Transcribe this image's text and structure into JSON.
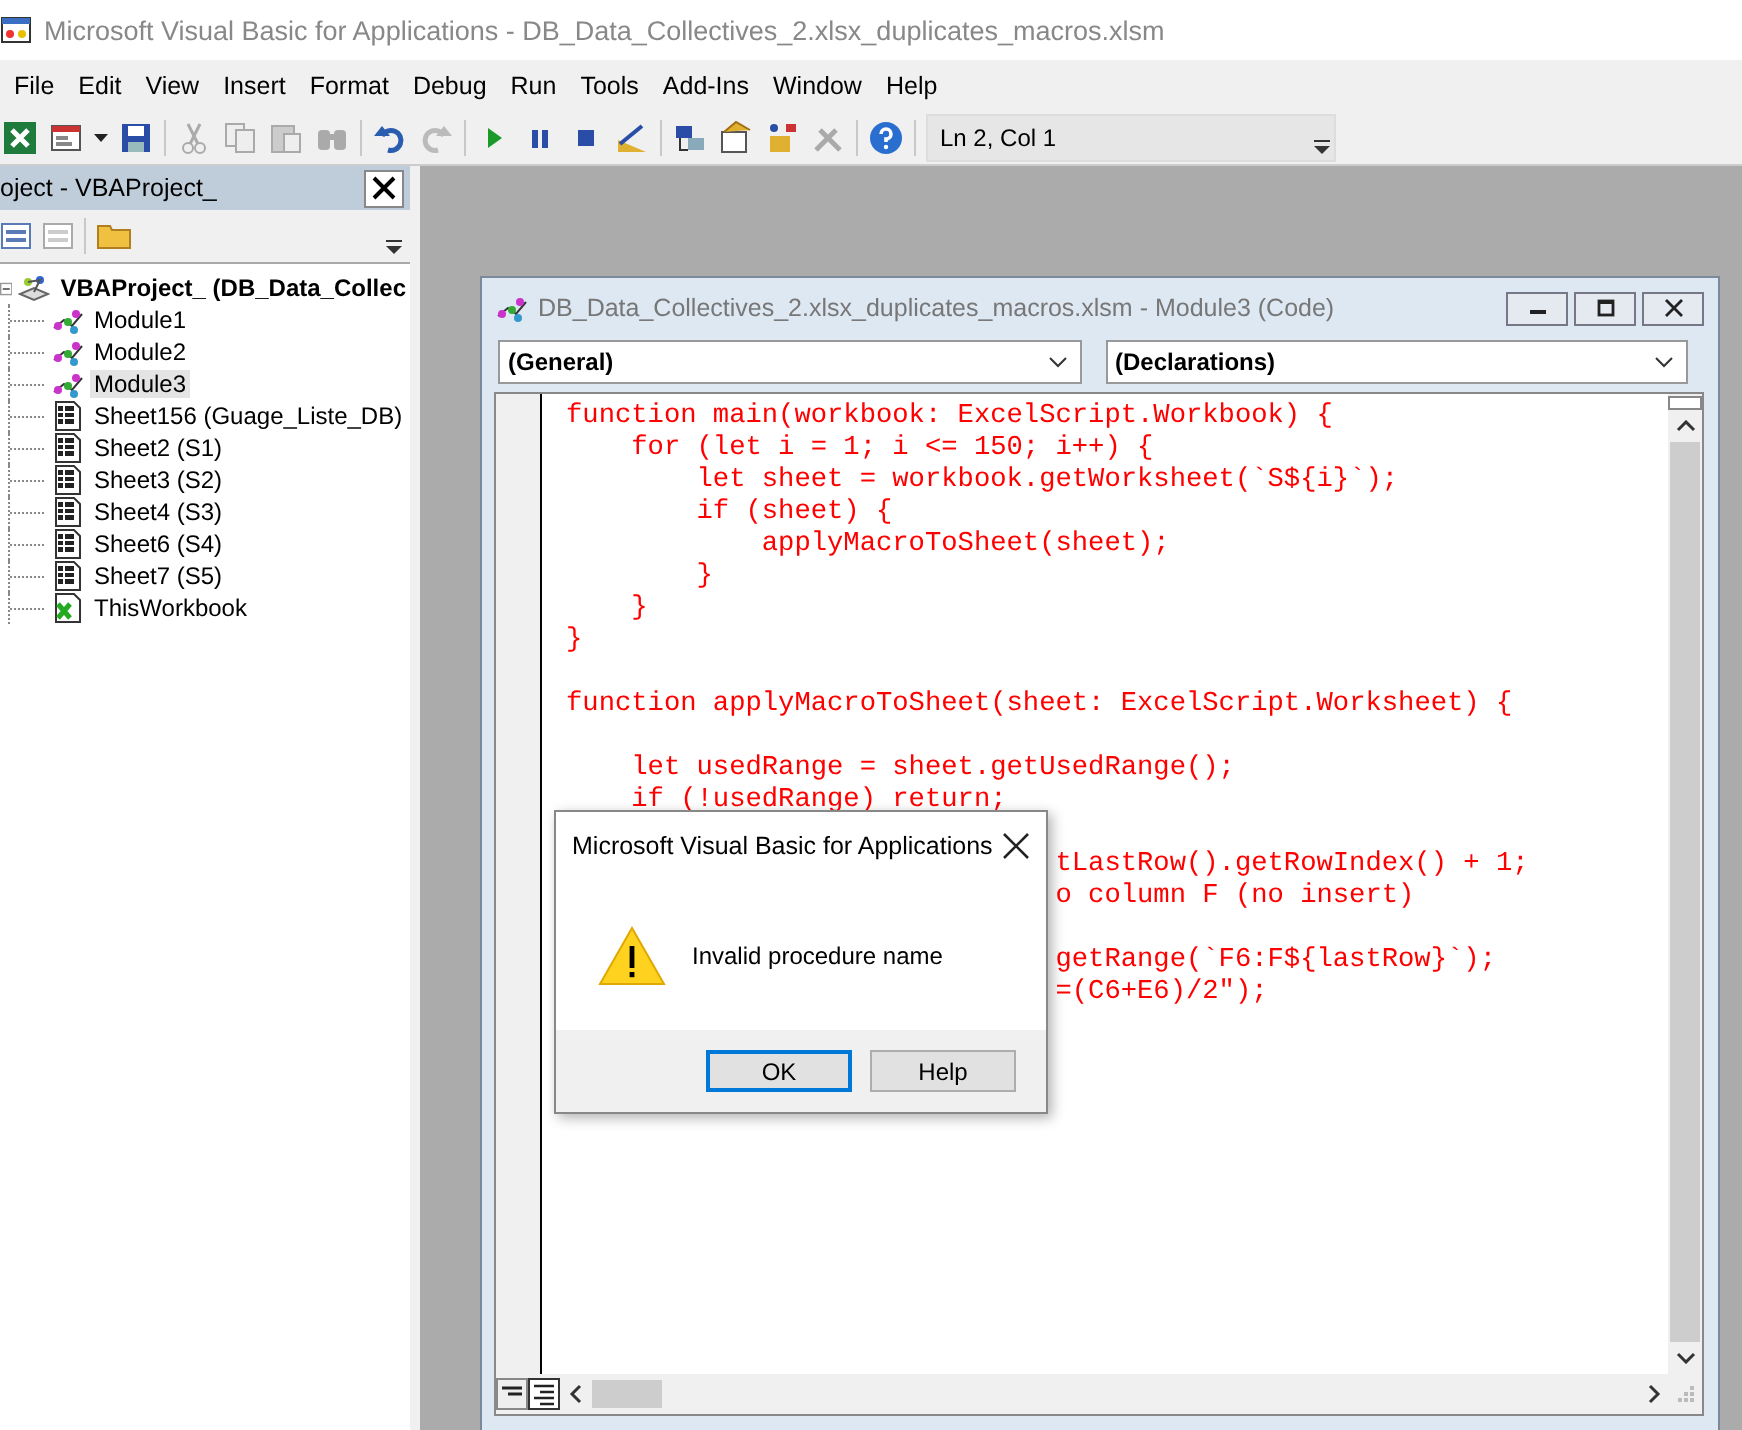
{
  "window": {
    "title": "Microsoft Visual Basic for Applications - DB_Data_Collectives_2.xlsx_duplicates_macros.xlsm"
  },
  "menu": [
    "File",
    "Edit",
    "View",
    "Insert",
    "Format",
    "Debug",
    "Run",
    "Tools",
    "Add-Ins",
    "Window",
    "Help"
  ],
  "toolbar": {
    "position": "Ln 2, Col 1"
  },
  "project_pane": {
    "title": "oject - VBAProject_",
    "tree": [
      {
        "label": "VBAProject_ (DB_Data_Collec",
        "kind": "project",
        "expanded": true,
        "selected": false,
        "children": [
          {
            "label": "Module1",
            "kind": "module",
            "selected": false
          },
          {
            "label": "Module2",
            "kind": "module",
            "selected": false
          },
          {
            "label": "Module3",
            "kind": "module",
            "selected": true
          },
          {
            "label": "Sheet156 (Guage_Liste_DB)",
            "kind": "sheet",
            "selected": false
          },
          {
            "label": "Sheet2 (S1)",
            "kind": "sheet",
            "selected": false
          },
          {
            "label": "Sheet3 (S2)",
            "kind": "sheet",
            "selected": false
          },
          {
            "label": "Sheet4 (S3)",
            "kind": "sheet",
            "selected": false
          },
          {
            "label": "Sheet6 (S4)",
            "kind": "sheet",
            "selected": false
          },
          {
            "label": "Sheet7 (S5)",
            "kind": "sheet",
            "selected": false
          },
          {
            "label": "ThisWorkbook",
            "kind": "workbook",
            "selected": false
          }
        ]
      }
    ]
  },
  "code_window": {
    "title": "DB_Data_Collectives_2.xlsx_duplicates_macros.xlsm - Module3 (Code)",
    "object_dropdown": "(General)",
    "procedure_dropdown": "(Declarations)",
    "blocks": [
      {
        "lines": [
          {
            "text": "function main(workbook: ExcelScript.Workbook) {",
            "kind": "full"
          },
          {
            "text": "    for (let i = 1; i <= 150; i++) {",
            "kind": "full"
          },
          {
            "text": "        let sheet = workbook.getWorksheet(`S${i}`);",
            "kind": "full"
          },
          {
            "text": "        if (sheet) {",
            "kind": "full"
          },
          {
            "text": "            applyMacroToSheet(sheet);",
            "kind": "full"
          },
          {
            "text": "        }",
            "kind": "full"
          },
          {
            "text": "    }",
            "kind": "full"
          },
          {
            "text": "}",
            "kind": "full"
          }
        ]
      },
      {
        "lines": [
          {
            "text": "function applyMacroToSheet(sheet: ExcelScript.Worksheet) {",
            "kind": "full"
          }
        ]
      },
      {
        "lines": [
          {
            "text": "    let usedRange = sheet.getUsedRange();",
            "kind": "full"
          },
          {
            "text": "    if (!usedRange) return;",
            "kind": "full"
          }
        ]
      },
      {
        "lines": [
          {
            "text": "tLastRow().getRowIndex() + 1;",
            "kind": "covered"
          },
          {
            "text": "o column F (no insert)",
            "kind": "covered"
          }
        ]
      },
      {
        "lines": [
          {
            "text": "getRange(`F6:F${lastRow}`);",
            "kind": "covered"
          },
          {
            "text": "=(C6+E6)/2\");",
            "kind": "covered"
          }
        ]
      }
    ]
  },
  "dialog": {
    "title": "Microsoft Visual Basic for Applications",
    "message": "Invalid procedure name",
    "buttons": [
      {
        "label": "OK",
        "default": true
      },
      {
        "label": "Help",
        "default": false
      }
    ]
  }
}
